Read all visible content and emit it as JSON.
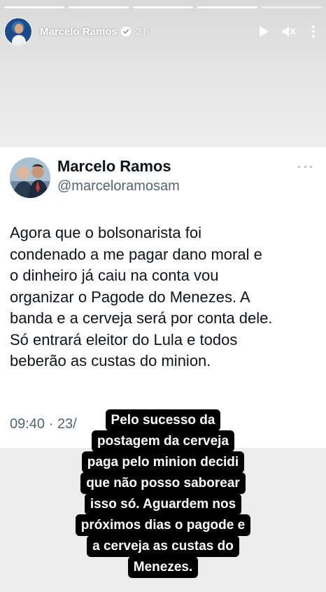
{
  "story": {
    "user_name": "Marcelo Ramos",
    "time_ago": "2 h",
    "progress": [
      1,
      1,
      1,
      1,
      0.0
    ],
    "verified": true,
    "icons": {
      "play": "play-icon",
      "mute": "speaker-muted-icon",
      "more": "more-vertical-icon"
    }
  },
  "tweet": {
    "name": "Marcelo Ramos",
    "handle": "@marceloramosam",
    "lines": [
      "Agora que o bolsonarista foi",
      "condenado a me pagar dano moral e",
      "o dinheiro já caiu na conta vou",
      "organizar o Pagode do Menezes. A",
      "banda e a cerveja será por conta dele.",
      "Só entrará eleitor do Lula e todos",
      "beberão as custas do minion."
    ],
    "timestamp": "09:40 · 23/",
    "more_icon": "more-horizontal-icon"
  },
  "caption": {
    "lines": [
      "Pelo sucesso da",
      "postagem da cerveja",
      "paga pelo minion decidi",
      "que não posso saborear",
      "isso só. Aguardem nos",
      "próximos dias o pagode e",
      "a cerveja as custas do",
      "Menezes."
    ]
  },
  "colors": {
    "caption_bg": "#000000",
    "caption_text": "#ffffff",
    "tweet_handle": "#536471",
    "tweet_text": "#0f1419"
  }
}
